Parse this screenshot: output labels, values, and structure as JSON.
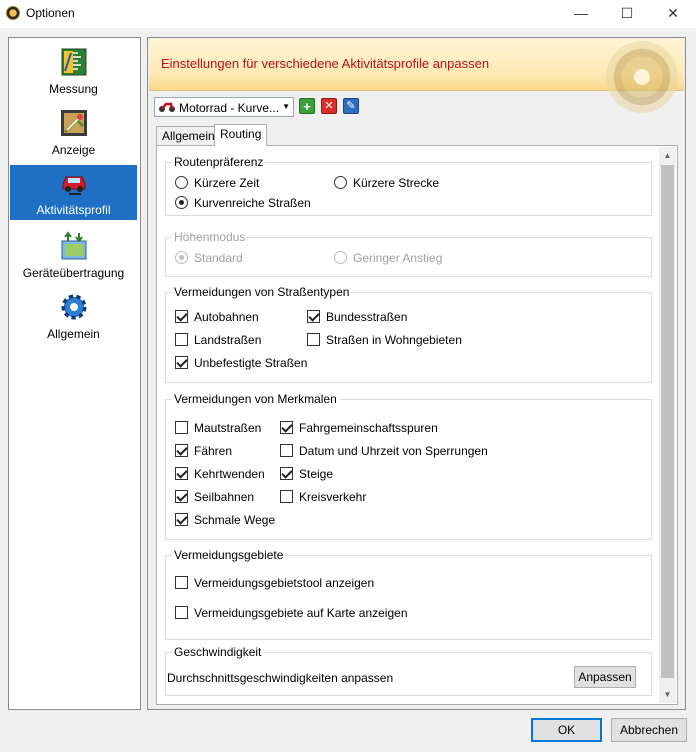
{
  "window": {
    "title": "Optionen"
  },
  "nav": [
    {
      "label": "Messung",
      "icon": "ruler-icon"
    },
    {
      "label": "Anzeige",
      "icon": "display-icon"
    },
    {
      "label": "Aktivitätsprofil",
      "icon": "car-icon"
    },
    {
      "label": "Geräteübertragung",
      "icon": "transfer-icon"
    },
    {
      "label": "Allgemein",
      "icon": "gear-icon"
    }
  ],
  "banner": {
    "text": "Einstellungen für verschiedene Aktivitätsprofile anpassen"
  },
  "profile": {
    "selected": "Motorrad - Kurve..."
  },
  "tabs": {
    "general": "Allgemein",
    "routing": "Routing"
  },
  "route_pref": {
    "title": "Routenpräferenz",
    "shorter_time": "Kürzere Zeit",
    "shorter_distance": "Kürzere Strecke",
    "curvy_roads": "Kurvenreiche Straßen"
  },
  "elevation": {
    "title": "Höhenmodus",
    "standard": "Standard",
    "low_climb": "Geringer Anstieg"
  },
  "road_types": {
    "title": "Vermeidungen von Straßentypen",
    "motorways": "Autobahnen",
    "federal_roads": "Bundesstraßen",
    "country_roads": "Landstraßen",
    "residential": "Straßen in Wohngebieten",
    "unpaved": "Unbefestigte Straßen"
  },
  "features": {
    "title": "Vermeidungen von Merkmalen",
    "tolls": "Mautstraßen",
    "carpool": "Fahrgemeinschaftsspuren",
    "ferries": "Fähren",
    "closure_dates": "Datum und Uhrzeit von Sperrungen",
    "u_turns": "Kehrtwenden",
    "climbs": "Steige",
    "cable_cars": "Seilbahnen",
    "roundabouts": "Kreisverkehr",
    "narrow_paths": "Schmale Wege"
  },
  "areas": {
    "title": "Vermeidungsgebiete",
    "show_tool": "Vermeidungsgebietstool anzeigen",
    "show_on_map": "Vermeidungsgebiete auf Karte anzeigen"
  },
  "speed": {
    "title": "Geschwindigkeit",
    "label": "Durchschnittsgeschwindigkeiten anpassen",
    "button": "Anpassen"
  },
  "footer": {
    "ok": "OK",
    "cancel": "Abbrechen"
  }
}
